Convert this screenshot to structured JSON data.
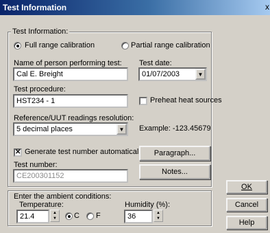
{
  "window": {
    "title": "Test Information",
    "close_glyph": "x"
  },
  "calibration": {
    "legend": "Test Information:",
    "full_label": "Full range calibration",
    "partial_label": "Partial range calibration",
    "selected": "full"
  },
  "person": {
    "label": "Name of person performing test:",
    "value": "Cal E. Breight"
  },
  "test_date": {
    "label": "Test date:",
    "value": "01/07/2003"
  },
  "procedure": {
    "label": "Test procedure:",
    "value": "HST234 - 1"
  },
  "preheat": {
    "label": "Preheat heat sources",
    "checked": false
  },
  "resolution": {
    "label": "Reference/UUT readings resolution:",
    "value": "5 decimal places",
    "example": "Example: -123.45679"
  },
  "generate": {
    "label": "Generate test number automatically",
    "checked": true
  },
  "test_number": {
    "label": "Test number:",
    "value": "CE200301152"
  },
  "buttons": {
    "paragraph": "Paragraph...",
    "notes": "Notes...",
    "ok": "OK",
    "cancel": "Cancel",
    "help": "Help"
  },
  "ambient": {
    "legend": "Enter the ambient conditions:",
    "temperature_label": "Temperature:",
    "temperature_value": "21.4",
    "unit_c": "C",
    "unit_f": "F",
    "unit_selected": "C",
    "humidity_label": "Humidity (%):",
    "humidity_value": "36"
  }
}
